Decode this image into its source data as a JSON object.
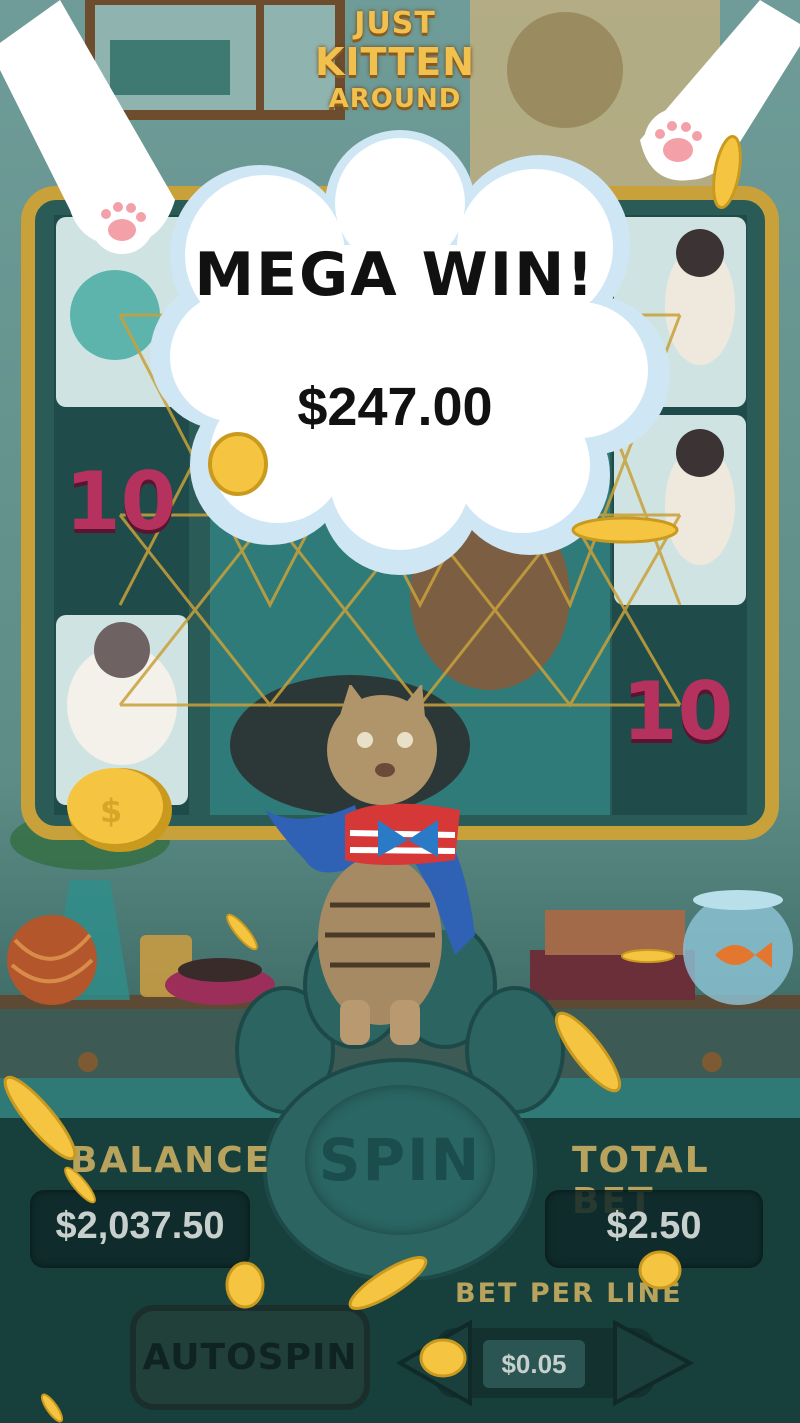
{
  "game": {
    "logo_line1": "JUST",
    "logo_line2": "KITTEN",
    "logo_line3": "AROUND"
  },
  "win_popup": {
    "title": "MEGA WIN!",
    "amount": "$247.00"
  },
  "reels": {
    "symbol_value": "10"
  },
  "controls": {
    "spin_label": "SPIN",
    "balance_label": "BALANCE",
    "balance_value": "$2,037.50",
    "total_bet_label": "TOTAL BET",
    "total_bet_value": "$2.50",
    "bet_per_line_label": "BET PER LINE",
    "bet_per_line_value": "$0.05",
    "autospin_label": "AUTOSPIN"
  },
  "colors": {
    "coin_gold": "#f5c542",
    "frame_gold": "#c9a13a",
    "panel_dark": "#0e2828",
    "label_gold": "#b8a35e"
  },
  "icons": [
    "paw-icon",
    "coin-icon",
    "arrow-left-icon",
    "arrow-right-icon",
    "yarn-icon",
    "fishbowl-icon"
  ]
}
